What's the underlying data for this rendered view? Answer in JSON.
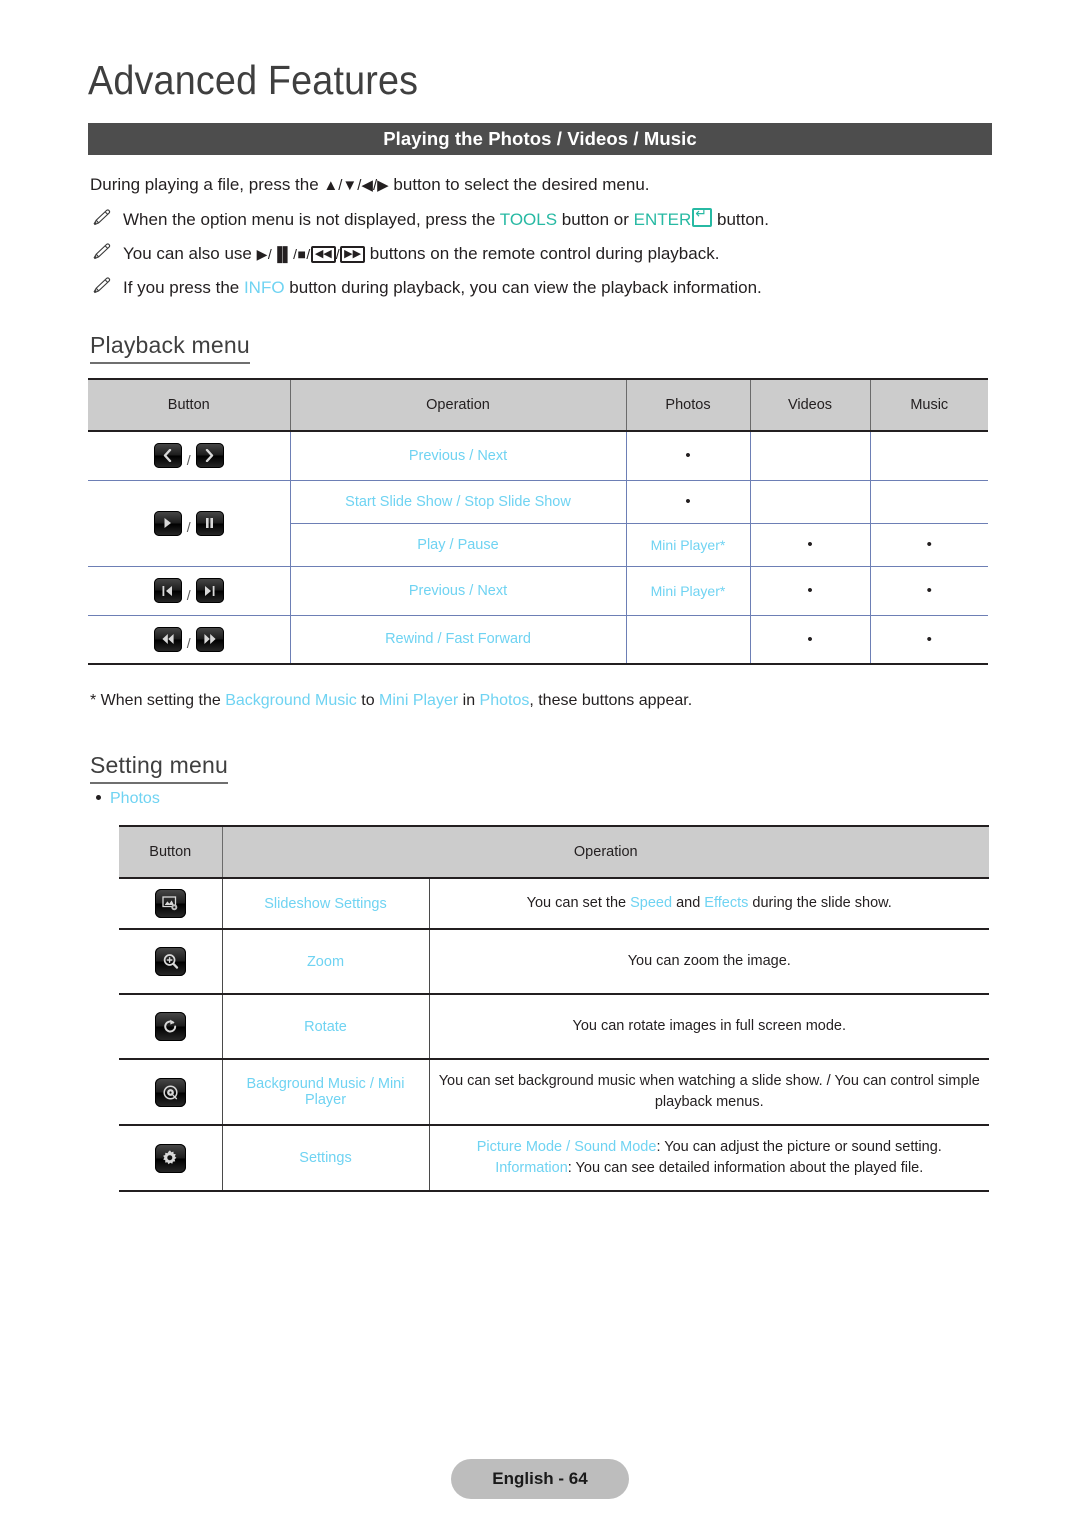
{
  "document": {
    "chapter_title": "Advanced Features",
    "section_bar_title": "Playing the Photos / Videos / Music",
    "footer": "English - 64"
  },
  "intro": {
    "line1_part1": "During playing a file, press the ",
    "line1_keys": "▲/▼/◀/▶",
    "line1_part2": " button to select the desired menu.",
    "bullet1_part1": "When the option menu is not displayed, press the ",
    "bullet1_tools": "TOOLS",
    "bullet1_part2": " button or ",
    "bullet1_enter": "ENTER",
    "bullet1_part3": " button.",
    "bullet2_part1": "You can also use ",
    "bullet2_keys_a": "▶/▐▌/■/",
    "bullet2_key_rew": "◀◀",
    "bullet2_slash": "/",
    "bullet2_key_ff": "▶▶",
    "bullet2_part2": " buttons on the remote control during playback.",
    "bullet3_part1": "If you press the ",
    "bullet3_info": "INFO",
    "bullet3_part2": " button during playback, you can view the playback information.",
    "pencil_icon": "pencil-icon"
  },
  "playback": {
    "heading": "Playback menu",
    "columns": [
      "Button",
      "Operation",
      "Photos",
      "Videos",
      "Music"
    ],
    "rows": [
      {
        "buttons": [
          "chevron-left-icon",
          "chevron-right-icon"
        ],
        "operation": "Previous / Next",
        "photos": "•",
        "videos": "",
        "music": ""
      },
      {
        "buttons": [
          "play-icon",
          "pause-icon"
        ],
        "operation": "Start Slide Show / Stop Slide Show",
        "photos": "•",
        "videos": "",
        "music": ""
      },
      {
        "buttons": [],
        "operation": "Play / Pause",
        "photos": "Mini Player*",
        "videos": "•",
        "music": "•"
      },
      {
        "buttons": [
          "skip-previous-icon",
          "skip-next-icon"
        ],
        "operation": "Previous / Next",
        "photos": "Mini Player*",
        "videos": "•",
        "music": "•"
      },
      {
        "buttons": [
          "rewind-icon",
          "fast-forward-icon"
        ],
        "operation": "Rewind / Fast Forward",
        "photos": "",
        "videos": "•",
        "music": "•"
      }
    ],
    "footnote": {
      "part1": "* When setting the ",
      "bgm": "Background Music",
      "part2": " to ",
      "mini": "Mini Player",
      "part3": " in ",
      "photos": "Photos",
      "part4": ", these buttons appear."
    }
  },
  "setting": {
    "heading": "Setting menu",
    "bullet_photos": "Photos",
    "columns": [
      "Button",
      "Operation"
    ],
    "rows": [
      {
        "icon": "slideshow-settings-icon",
        "name": "Slideshow Settings",
        "desc_part1": "You can set the ",
        "desc_hl1": "Speed",
        "desc_part2": " and ",
        "desc_hl2": "Effects",
        "desc_part3": " during the slide show."
      },
      {
        "icon": "zoom-icon",
        "name": "Zoom",
        "desc_part1": "You can zoom the image.",
        "desc_hl1": "",
        "desc_part2": "",
        "desc_hl2": "",
        "desc_part3": ""
      },
      {
        "icon": "rotate-icon",
        "name": "Rotate",
        "desc_part1": "You can rotate images in full screen mode.",
        "desc_hl1": "",
        "desc_part2": "",
        "desc_hl2": "",
        "desc_part3": ""
      },
      {
        "icon": "background-music-icon",
        "name": "Background Music / Mini Player",
        "desc_part1": "You can set background music when watching a slide show. / You can control simple playback menus.",
        "desc_hl1": "",
        "desc_part2": "",
        "desc_hl2": "",
        "desc_part3": ""
      },
      {
        "icon": "settings-gear-icon",
        "name": "Settings",
        "line1_hl": "Picture Mode / Sound Mode",
        "line1_text": ": You can adjust the picture or sound setting.",
        "line2_hl": "Information",
        "line2_text": ": You can see detailed information about the played file."
      }
    ]
  },
  "colors": {
    "accent_cyan": "#6fd3f2",
    "accent_teal": "#27b9a3",
    "bar_gray": "#4d4d4d",
    "header_gray": "#cccccc",
    "footer_gray": "#bdbdbd"
  }
}
